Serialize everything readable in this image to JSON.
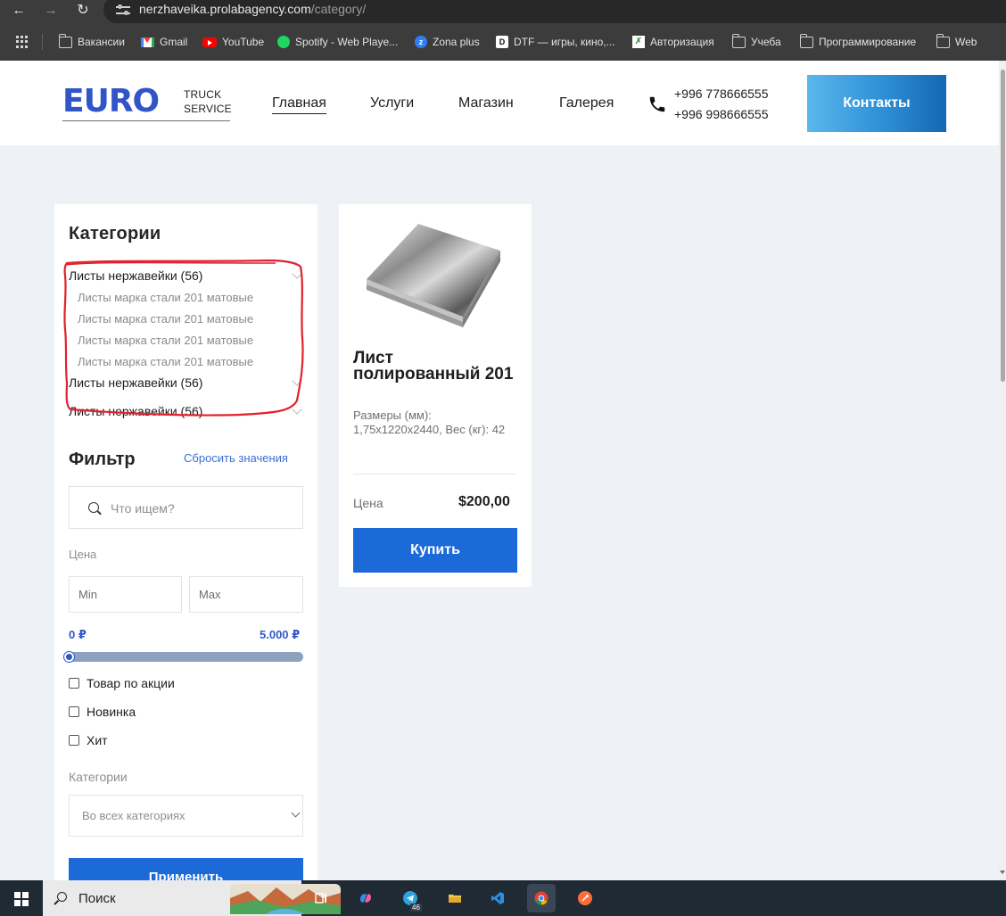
{
  "browser": {
    "url_host": "nerzhaveika.prolabagency.com",
    "url_path": "/category/",
    "bookmarks": [
      {
        "label": "Вакансии",
        "icon": "folder-icon"
      },
      {
        "label": "Gmail",
        "icon": "gmail-icon"
      },
      {
        "label": "YouTube",
        "icon": "youtube-icon"
      },
      {
        "label": "Spotify - Web Playe...",
        "icon": "spotify-icon"
      },
      {
        "label": "Zona plus",
        "icon": "zona-icon"
      },
      {
        "label": "DTF — игры, кино,...",
        "icon": "dtf-icon"
      },
      {
        "label": "Авторизация",
        "icon": "auth-icon"
      },
      {
        "label": "Учеба",
        "icon": "folder-icon"
      },
      {
        "label": "Программирование",
        "icon": "folder-icon"
      },
      {
        "label": "Web",
        "icon": "folder-icon"
      }
    ]
  },
  "header": {
    "logo_main": "EURO",
    "logo_line1": "TRUCK",
    "logo_line2": "SERVICE",
    "nav": [
      "Главная",
      "Услуги",
      "Магазин",
      "Галерея"
    ],
    "phone1": "+996 778666555",
    "phone2": "+996 998666555",
    "contacts_label": "Контакты"
  },
  "sidebar": {
    "categories_title": "Категории",
    "categories": [
      {
        "label": "Листы нержавейки (56)",
        "children": [
          "Листы марка стали 201 матовые",
          "Листы марка стали 201 матовые",
          "Листы марка стали 201 матовые",
          "Листы марка стали 201 матовые"
        ]
      },
      {
        "label": "Листы нержавейки (56)",
        "children": []
      },
      {
        "label": "Листы нержавейки (56)",
        "children": []
      }
    ],
    "filter_title": "Фильтр",
    "reset_label": "Сбросить значения",
    "search_placeholder": "Что ищем?",
    "price_label": "Цена",
    "min_placeholder": "Min",
    "max_placeholder": "Max",
    "range_min": "0 ₽",
    "range_max": "5.000 ₽",
    "range_position": 0,
    "checkboxes": [
      "Товар по акции",
      "Новинка",
      "Хит"
    ],
    "categories_label": "Категории",
    "category_select_value": "Во всех категориях",
    "apply_label": "Применить"
  },
  "product": {
    "title": "Лист полированный 201",
    "description": "Размеры (мм): 1,75x1220x2440, Вес (кг): 42",
    "price_caption": "Цена",
    "price": "$200,00",
    "buy_label": "Купить"
  },
  "taskbar": {
    "search_label": "Поиск",
    "telegram_badge": "46"
  },
  "colors": {
    "accent_blue": "#1b6ad8",
    "logo_blue": "#3154c9",
    "annotation_red": "#e0222e"
  }
}
